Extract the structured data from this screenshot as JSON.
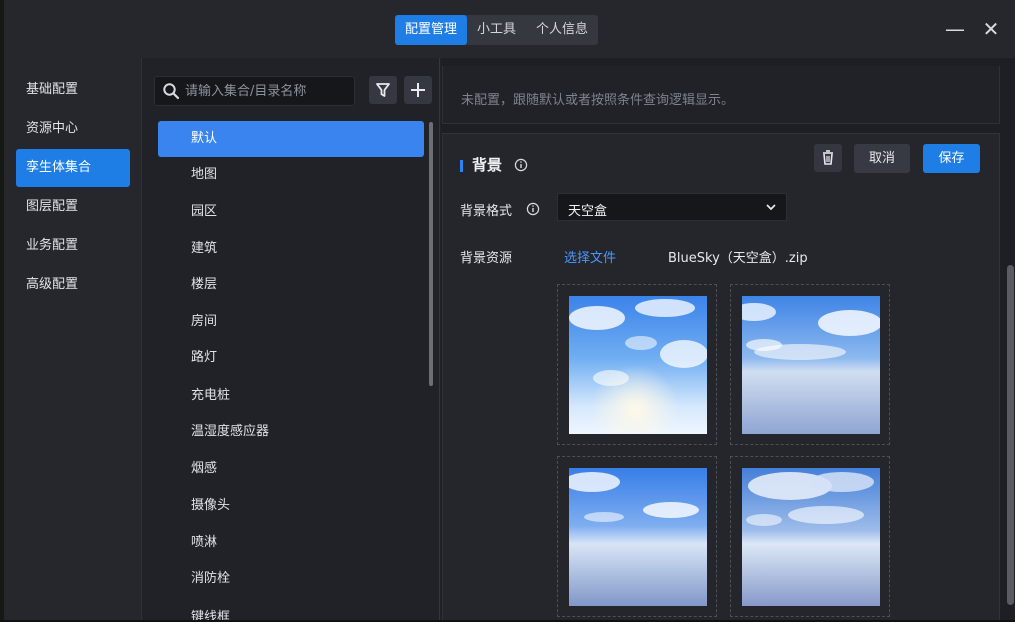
{
  "titlebar": {
    "tabs": [
      {
        "label": "配置管理",
        "active": true
      },
      {
        "label": "小工具",
        "active": false
      },
      {
        "label": "个人信息",
        "active": false
      }
    ],
    "minimize": "—",
    "close": "✕"
  },
  "left_nav": {
    "items": [
      {
        "label": "基础配置",
        "active": false
      },
      {
        "label": "资源中心",
        "active": false
      },
      {
        "label": "孪生体集合",
        "active": true
      },
      {
        "label": "图层配置",
        "active": false
      },
      {
        "label": "业务配置",
        "active": false
      },
      {
        "label": "高级配置",
        "active": false
      }
    ]
  },
  "middle": {
    "search": {
      "placeholder": "请输入集合/目录名称",
      "value": ""
    },
    "list": [
      "默认",
      "地图",
      "园区",
      "建筑",
      "楼层",
      "房间",
      "路灯",
      "充电桩",
      "温湿度感应器",
      "烟感",
      "摄像头",
      "喷淋",
      "消防栓",
      "键线框"
    ]
  },
  "right": {
    "notice": "未配置，跟随默认或者按照条件查询逻辑显示。",
    "section_title": "背景",
    "buttons": {
      "cancel": "取消",
      "save": "保存"
    },
    "bg_format": {
      "label": "背景格式",
      "value": "天空盒"
    },
    "bg_resource": {
      "label": "背景资源",
      "choose": "选择文件",
      "filename": "BlueSky（天空盒）.zip"
    }
  },
  "colors": {
    "accent": "#1e7ee6",
    "selected_item": "#3a84f0",
    "link": "#4a97ff",
    "panel": "#24262c"
  }
}
